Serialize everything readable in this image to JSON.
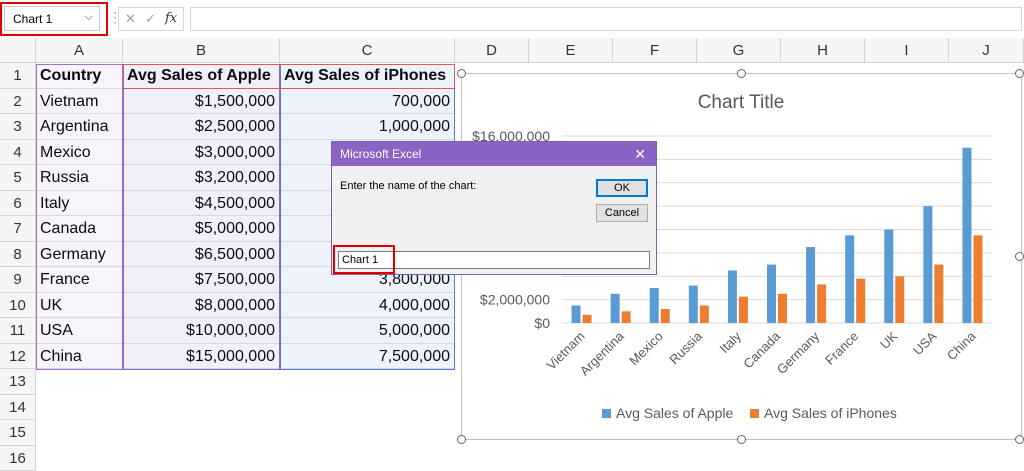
{
  "formula_bar": {
    "name_box": "Chart 1",
    "cancel_icon": "x-icon",
    "enter_icon": "check-icon",
    "fx_label": "fx",
    "formula": ""
  },
  "colors": {
    "apple": "#5b9bd5",
    "iphones": "#ed7d31",
    "highlight_red": "#e00000",
    "dialog_title": "#8a64c5"
  },
  "columns": [
    "A",
    "B",
    "C",
    "D",
    "E",
    "F",
    "G",
    "H",
    "I",
    "J"
  ],
  "rows": [
    "1",
    "2",
    "3",
    "4",
    "5",
    "6",
    "7",
    "8",
    "9",
    "10",
    "11",
    "12",
    "13",
    "14",
    "15",
    "16"
  ],
  "table": {
    "headers": [
      "Country",
      "Avg Sales of Apple",
      "Avg Sales of iPhones"
    ],
    "data": [
      [
        "Vietnam",
        "$1,500,000",
        "700,000"
      ],
      [
        "Argentina",
        "$2,500,000",
        "1,000,000"
      ],
      [
        "Mexico",
        "$3,000,000",
        ""
      ],
      [
        "Russia",
        "$3,200,000",
        ""
      ],
      [
        "Italy",
        "$4,500,000",
        ""
      ],
      [
        "Canada",
        "$5,000,000",
        ""
      ],
      [
        "Germany",
        "$6,500,000",
        ""
      ],
      [
        "France",
        "$7,500,000",
        "3,800,000"
      ],
      [
        "UK",
        "$8,000,000",
        "4,000,000"
      ],
      [
        "USA",
        "$10,000,000",
        "5,000,000"
      ],
      [
        "China",
        "$15,000,000",
        "7,500,000"
      ]
    ]
  },
  "chart_data": {
    "type": "bar",
    "title": "Chart Title",
    "categories": [
      "Vietnam",
      "Argentina",
      "Mexico",
      "Russia",
      "Italy",
      "Canada",
      "Germany",
      "France",
      "UK",
      "USA",
      "China"
    ],
    "series": [
      {
        "name": "Avg Sales of Apple",
        "values": [
          1500000,
          2500000,
          3000000,
          3200000,
          4500000,
          5000000,
          6500000,
          7500000,
          8000000,
          10000000,
          15000000
        ]
      },
      {
        "name": "Avg Sales of iPhones",
        "values": [
          700000,
          1000000,
          1200000,
          1500000,
          2250000,
          2500000,
          3300000,
          3800000,
          4000000,
          5000000,
          7500000
        ]
      }
    ],
    "ylim": [
      0,
      16000000
    ],
    "y_tick_labels": [
      "$16,000,000",
      "$2,000,000",
      "$0"
    ],
    "legend": "bottom",
    "grid": true
  },
  "dialog": {
    "title": "Microsoft Excel",
    "prompt": "Enter the name of the chart:",
    "ok_label": "OK",
    "cancel_label": "Cancel",
    "input_value": "Chart 1"
  }
}
